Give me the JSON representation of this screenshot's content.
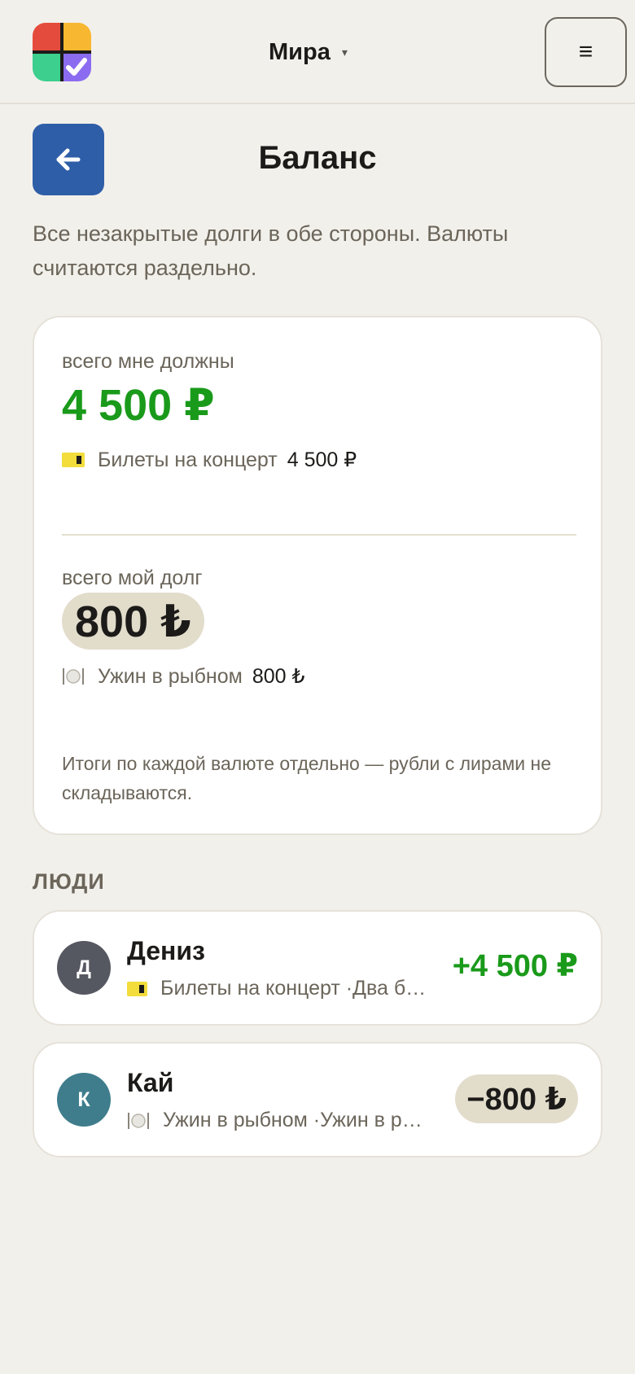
{
  "header": {
    "user_name": "Мира",
    "caret": "▾",
    "menu_glyph": "≡"
  },
  "page": {
    "title": "Баланс",
    "intro": "Все незакрытые долги в обе стороны. Валюты считаются раздельно."
  },
  "summary": {
    "owed_to_me_label": "всего мне должны",
    "owed_to_me_total": "4 500 ₽",
    "owed_to_me_item": {
      "label": "Билеты на концерт",
      "amount": "4 500 ₽"
    },
    "my_debt_label": "всего мой долг",
    "my_debt_total": "800 ₺",
    "my_debt_item": {
      "label": "Ужин в рыбном",
      "amount": "800 ₺"
    },
    "note": "Итоги по каждой валюте отдельно — рубли с лирами не складываются."
  },
  "people_section": {
    "title": "ЛЮДИ",
    "people": [
      {
        "initial": "Д",
        "name": "Дениз",
        "sub": "Билеты на концерт ·Два билета",
        "amount": "+4 500 ₽"
      },
      {
        "initial": "К",
        "name": "Кай",
        "sub": "Ужин в рыбном ·Ужин в рыбном",
        "amount": "−800 ₺"
      }
    ]
  },
  "colors": {
    "positive": "#1a9a1a",
    "accent": "#2f5ea8",
    "avatar_1": "#555860",
    "avatar_2": "#3f7d8c"
  }
}
